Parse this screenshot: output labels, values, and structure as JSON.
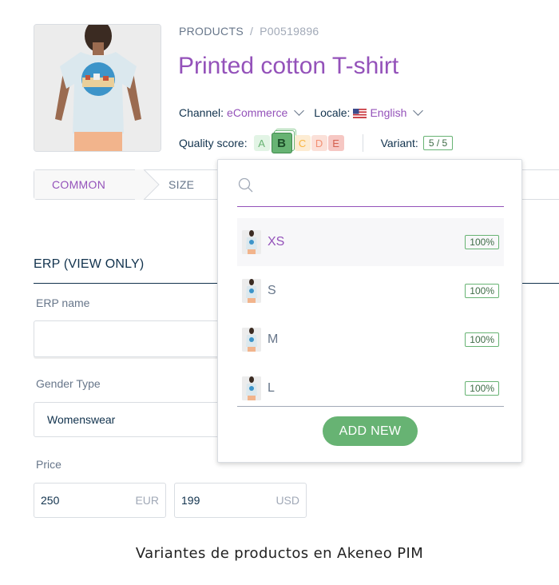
{
  "breadcrumb": {
    "root": "PRODUCTS",
    "separator": "/",
    "sku": "P00519896"
  },
  "product": {
    "title": "Printed cotton T-shirt",
    "image_icon": "tshirt-product-photo"
  },
  "channel": {
    "label": "Channel:",
    "value": "eCommerce"
  },
  "locale": {
    "label": "Locale:",
    "value": "English",
    "flag_icon": "us-flag-icon"
  },
  "quality": {
    "label": "Quality score:",
    "grades": [
      "A",
      "B",
      "C",
      "D",
      "E"
    ],
    "current": "B"
  },
  "variant": {
    "label": "Variant:",
    "count": "5 / 5"
  },
  "tabs": [
    {
      "label": "COMMON"
    },
    {
      "label": "SIZE"
    }
  ],
  "section": {
    "title": "ERP (VIEW ONLY)"
  },
  "fields": {
    "erp_name": {
      "label": "ERP name",
      "value": ""
    },
    "gender": {
      "label": "Gender Type",
      "value": "Womenswear"
    },
    "price": {
      "label": "Price",
      "eur_value": "250",
      "eur_currency": "EUR",
      "usd_value": "199",
      "usd_currency": "USD"
    }
  },
  "dropdown": {
    "search_placeholder": "",
    "options": [
      {
        "label": "XS",
        "completeness": "100%",
        "selected": true
      },
      {
        "label": "S",
        "completeness": "100%",
        "selected": false
      },
      {
        "label": "M",
        "completeness": "100%",
        "selected": false
      },
      {
        "label": "L",
        "completeness": "100%",
        "selected": false
      }
    ],
    "add_new_label": "ADD NEW"
  },
  "caption": "Variantes de productos en Akeneo PIM",
  "colors": {
    "accent": "#9452ba",
    "success": "#67b373",
    "text": "#11324d",
    "muted": "#67768a"
  }
}
